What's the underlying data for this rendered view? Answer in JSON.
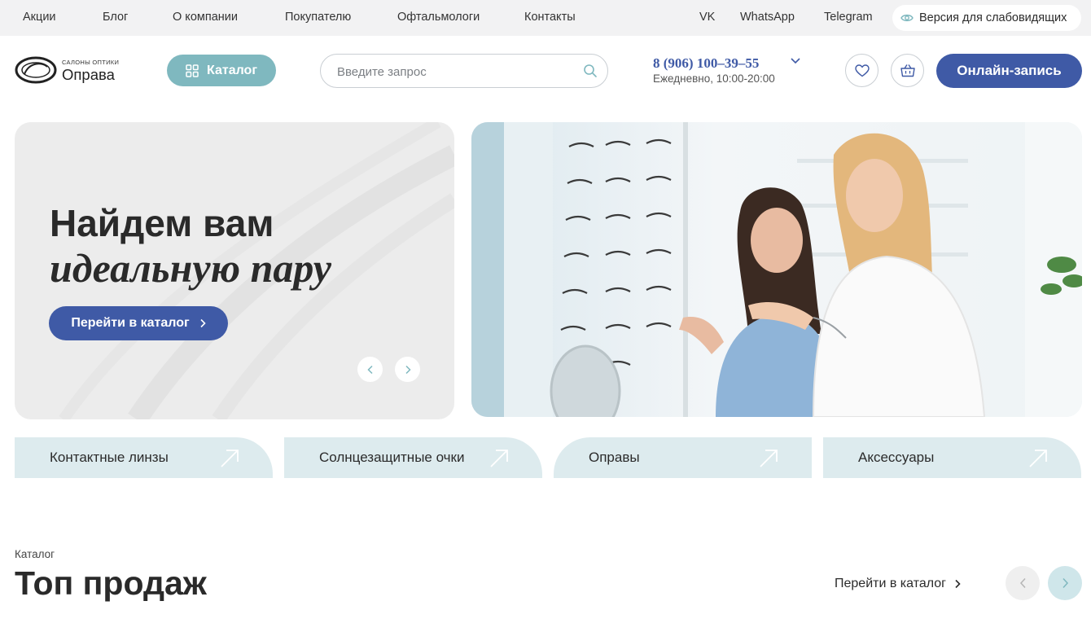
{
  "topnav": {
    "links": [
      "Акции",
      "Блог",
      "О компании",
      "Покупателю",
      "Офтальмологи",
      "Контакты"
    ],
    "social": [
      "VK",
      "WhatsApp",
      "Telegram"
    ],
    "low_vision_label": "Версия для слабовидящих",
    "low_vision_icon": "eye-icon"
  },
  "header": {
    "logo": {
      "small": "САЛОНЫ ОПТИКИ",
      "big": "Оправа",
      "emblem_text": "ОПРАВА"
    },
    "catalog_button": "Каталог",
    "search": {
      "placeholder": "Введите запрос",
      "value": ""
    },
    "phone": "8 (906) 100–39–55",
    "hours": "Ежедневно, 10:00-20:00",
    "online_button": "Онлайн-запись"
  },
  "hero": {
    "title_line1": "Найдем вам",
    "title_line2": "идеальную пару",
    "button": "Перейти в каталог"
  },
  "categories": [
    "Контактные линзы",
    "Солнцезащитные очки",
    "Оправы",
    "Аксессуары"
  ],
  "section": {
    "label": "Каталог",
    "title": "Топ продаж",
    "link": "Перейти в каталог"
  },
  "colors": {
    "accent": "#3f5aa6",
    "teal": "#7fb8bf",
    "tile": "#ddebee",
    "topbar": "#f2f2f3"
  }
}
